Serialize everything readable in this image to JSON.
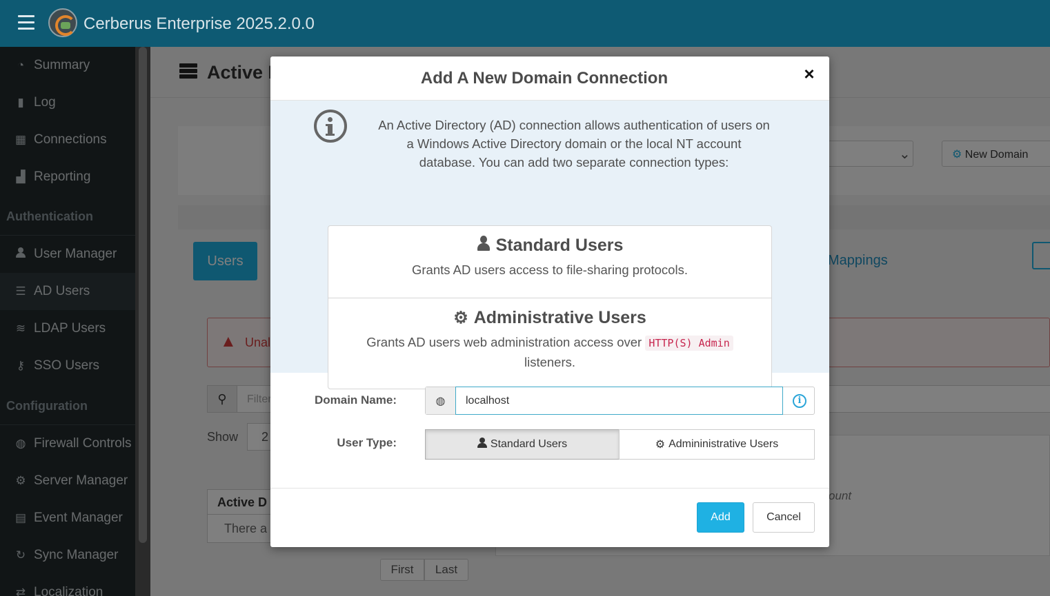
{
  "app": {
    "title": "Cerberus Enterprise 2025.2.0.0"
  },
  "sidebar": {
    "items": [
      {
        "label": "Summary",
        "icon": "dashboard-icon"
      },
      {
        "label": "Log",
        "icon": "book-icon"
      },
      {
        "label": "Connections",
        "icon": "grid-icon"
      },
      {
        "label": "Reporting",
        "icon": "bar-chart-icon"
      }
    ],
    "section_auth": "Authentication",
    "auth_items": [
      {
        "label": "User Manager",
        "icon": "user-icon"
      },
      {
        "label": "AD Users",
        "icon": "server-icon",
        "active": true
      },
      {
        "label": "LDAP Users",
        "icon": "database-icon"
      },
      {
        "label": "SSO Users",
        "icon": "key-icon"
      }
    ],
    "section_config": "Configuration",
    "config_items": [
      {
        "label": "Firewall Controls",
        "icon": "globe-icon"
      },
      {
        "label": "Server Manager",
        "icon": "gear-icon"
      },
      {
        "label": "Event Manager",
        "icon": "calendar-icon"
      },
      {
        "label": "Sync Manager",
        "icon": "refresh-icon"
      },
      {
        "label": "Localization",
        "icon": "exchange-icon"
      }
    ]
  },
  "background": {
    "page_title": "Active I",
    "new_domain": "New Domain",
    "tab_users": "Users",
    "tab_mappings": "Mappings",
    "alert_text": "Unal",
    "filter_placeholder": "Filter",
    "show_label": "Show",
    "show_value": "2",
    "table_header": "Active D",
    "table_empty": "There a",
    "account_text": "ount",
    "pager_first": "First",
    "pager_last": "Last"
  },
  "modal": {
    "title": "Add A New Domain Connection",
    "close_label": "×",
    "info_text": "An Active Directory (AD) connection allows authentication of users on a Windows Active Directory domain or the local NT account database. You can add two separate connection types:",
    "standard_title": "Standard Users",
    "standard_desc": "Grants AD users access to file-sharing protocols.",
    "admin_title": "Administrative Users",
    "admin_desc_before": "Grants AD users web administration access over",
    "admin_desc_code": "HTTP(S) Admin",
    "admin_desc_after": "listeners.",
    "domain_label": "Domain Name:",
    "domain_value": "localhost",
    "usertype_label": "User Type:",
    "usertype_standard": "Standard Users",
    "usertype_admin": "Admininistrative Users",
    "add_label": "Add",
    "cancel_label": "Cancel"
  },
  "colors": {
    "topbar": "#0e5a73",
    "sidebar": "#232a2d",
    "primary": "#1fb1e3",
    "info_bg": "#e8f1f8",
    "highlight": "#f3f20c"
  }
}
